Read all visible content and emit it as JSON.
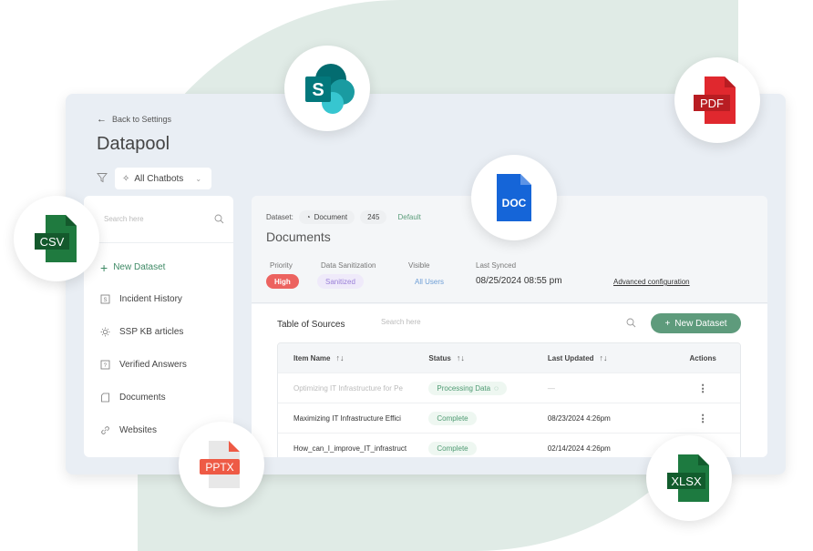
{
  "colors": {
    "accent_green": "#5e9b7c",
    "background_blob": "#e0ebe6",
    "priority_high": "#ec6360",
    "sanitized_purple": "#9a80d8",
    "visible_blue": "#6d9ed6"
  },
  "header": {
    "back_label": "Back to Settings",
    "title": "Datapool",
    "chatbot_select": "All Chatbots"
  },
  "sidebar": {
    "search_placeholder": "Search here",
    "new_dataset_label": "New Dataset",
    "items": [
      {
        "label": "Incident History",
        "icon": "incident-icon"
      },
      {
        "label": "SSP KB articles",
        "icon": "lightbulb-icon"
      },
      {
        "label": "Verified Answers",
        "icon": "question-icon"
      },
      {
        "label": "Documents",
        "icon": "document-icon"
      },
      {
        "label": "Websites",
        "icon": "link-icon"
      }
    ]
  },
  "main": {
    "dataset_label": "Dataset:",
    "dataset_type": "Document",
    "dataset_count": "245",
    "dataset_default": "Default",
    "title": "Documents",
    "meta": {
      "priority_label": "Priority",
      "priority_value": "High",
      "sanitization_label": "Data Sanitization",
      "sanitization_value": "Sanitized",
      "visible_label": "Visible",
      "visible_value": "All Users",
      "synced_label": "Last Synced",
      "synced_value": "08/25/2024  08:55 pm",
      "advanced_label": "Advanced configuration"
    },
    "sources": {
      "title": "Table of Sources",
      "search_placeholder": "Search here",
      "new_button": "New Dataset",
      "columns": [
        "Item Name",
        "Status",
        "Last Updated",
        "Actions"
      ],
      "rows": [
        {
          "name": "Optimizing IT Infrastructure for Pe",
          "status": "Processing Data",
          "updated": "—"
        },
        {
          "name": "Maximizing IT Infrastructure Effici",
          "status": "Complete",
          "updated": "08/23/2024 4:26pm"
        },
        {
          "name": "How_can_I_improve_IT_infrastruct",
          "status": "Complete",
          "updated": "02/14/2024 4:26pm"
        }
      ]
    }
  },
  "floating_icons": [
    {
      "name": "sharepoint",
      "label": "S"
    },
    {
      "name": "pdf",
      "label": "PDF"
    },
    {
      "name": "doc",
      "label": "DOC"
    },
    {
      "name": "csv",
      "label": "CSV"
    },
    {
      "name": "pptx",
      "label": "PPTX"
    },
    {
      "name": "xlsx",
      "label": "XLSX"
    }
  ]
}
